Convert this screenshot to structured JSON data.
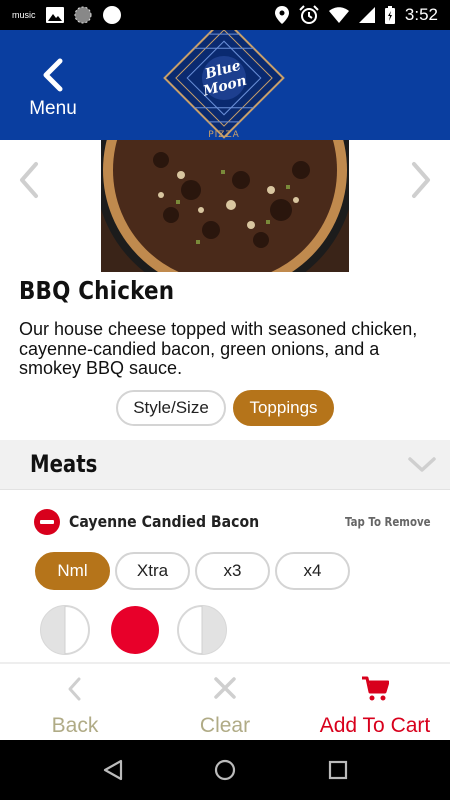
{
  "status_bar": {
    "music_label": "music",
    "time": "3:52",
    "icons": [
      "amazon-music-icon",
      "image-icon",
      "globe-icon",
      "circle-icon",
      "location-icon",
      "alarm-icon",
      "wifi-icon",
      "signal-icon",
      "battery-icon"
    ]
  },
  "header": {
    "menu_label": "Menu",
    "logo": {
      "line1": "Blue",
      "line2": "Moon",
      "sub": "PIZZA"
    },
    "background_color": "#0a3ea0"
  },
  "product": {
    "title": "BBQ Chicken",
    "description": "Our house cheese topped with seasoned chicken, cayenne-candied bacon, green onions, and a smokey BBQ sauce."
  },
  "tabs": [
    {
      "label": "Style/Size",
      "selected": false
    },
    {
      "label": "Toppings",
      "selected": true
    }
  ],
  "section": {
    "title": "Meats"
  },
  "topping": {
    "name": "Cayenne Candied Bacon",
    "action": "Tap To Remove",
    "amounts": [
      {
        "label": "Nml",
        "selected": true
      },
      {
        "label": "Xtra",
        "selected": false
      },
      {
        "label": "x3",
        "selected": false
      },
      {
        "label": "x4",
        "selected": false
      }
    ],
    "portions": [
      "left-half",
      "whole",
      "right-half"
    ],
    "selected_portion": "whole"
  },
  "bottom_bar": {
    "back_label": "Back",
    "clear_label": "Clear",
    "cart_label": "Add To Cart"
  },
  "colors": {
    "accent": "#b5741a",
    "red": "#d8001c",
    "muted": "#b0ab86"
  }
}
